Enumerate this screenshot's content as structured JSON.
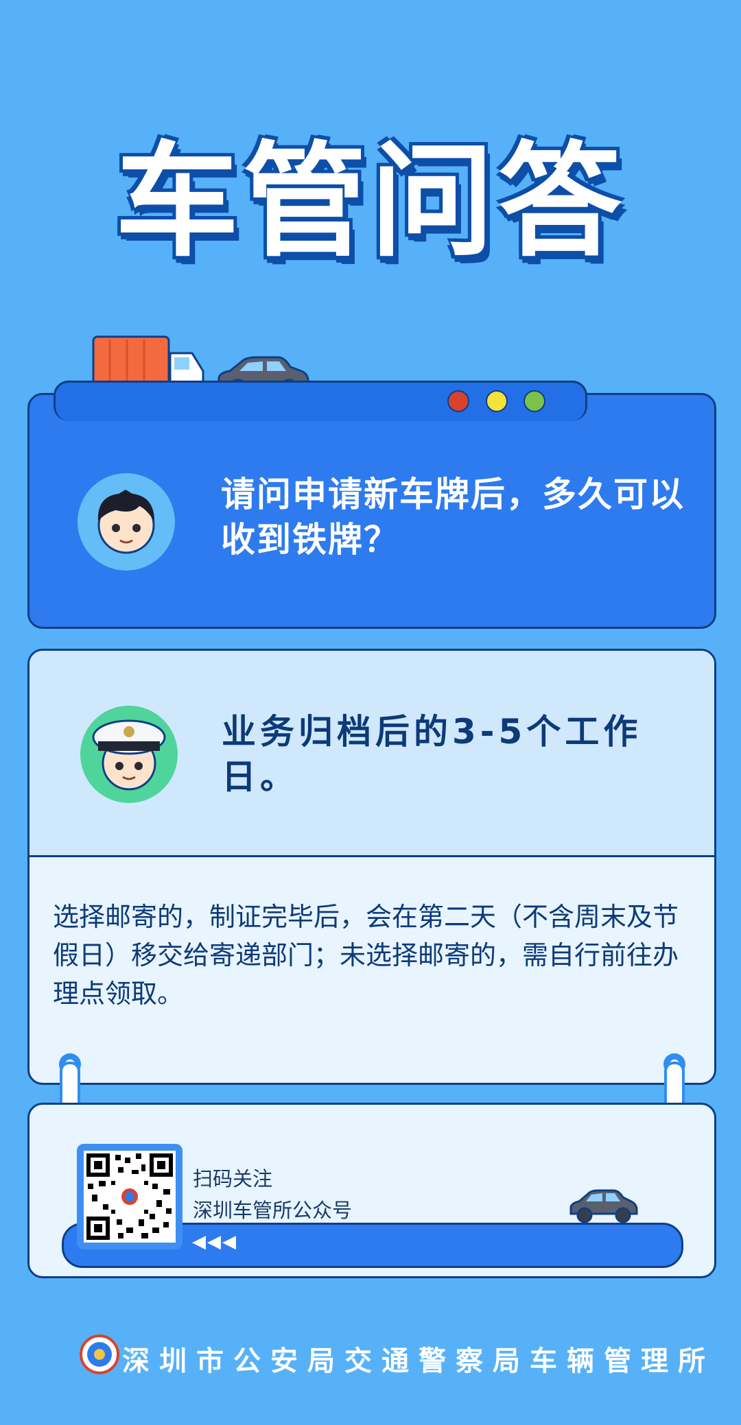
{
  "title": "车管问答",
  "question": {
    "text": "请问申请新车牌后，多久可以收到铁牌？",
    "dots": [
      "#d8432e",
      "#f2e23a",
      "#7bc24b"
    ]
  },
  "answer": {
    "headline": "业务归档后的3-5个工作日。",
    "detail": "选择邮寄的，制证完毕后，会在第二天（不含周末及节假日）移交给寄递部门；未选择邮寄的，需自行前往办理点领取。"
  },
  "qr": {
    "line1": "扫码关注",
    "line2": "深圳车管所公众号",
    "arrows": "◀◀◀"
  },
  "footer": {
    "org": "深圳市公安局交通警察局车辆管理所"
  },
  "colors": {
    "background": "#56b1f8",
    "card_blue": "#2d7bee",
    "outline": "#0e3f86",
    "text_dark": "#0d3a78"
  }
}
